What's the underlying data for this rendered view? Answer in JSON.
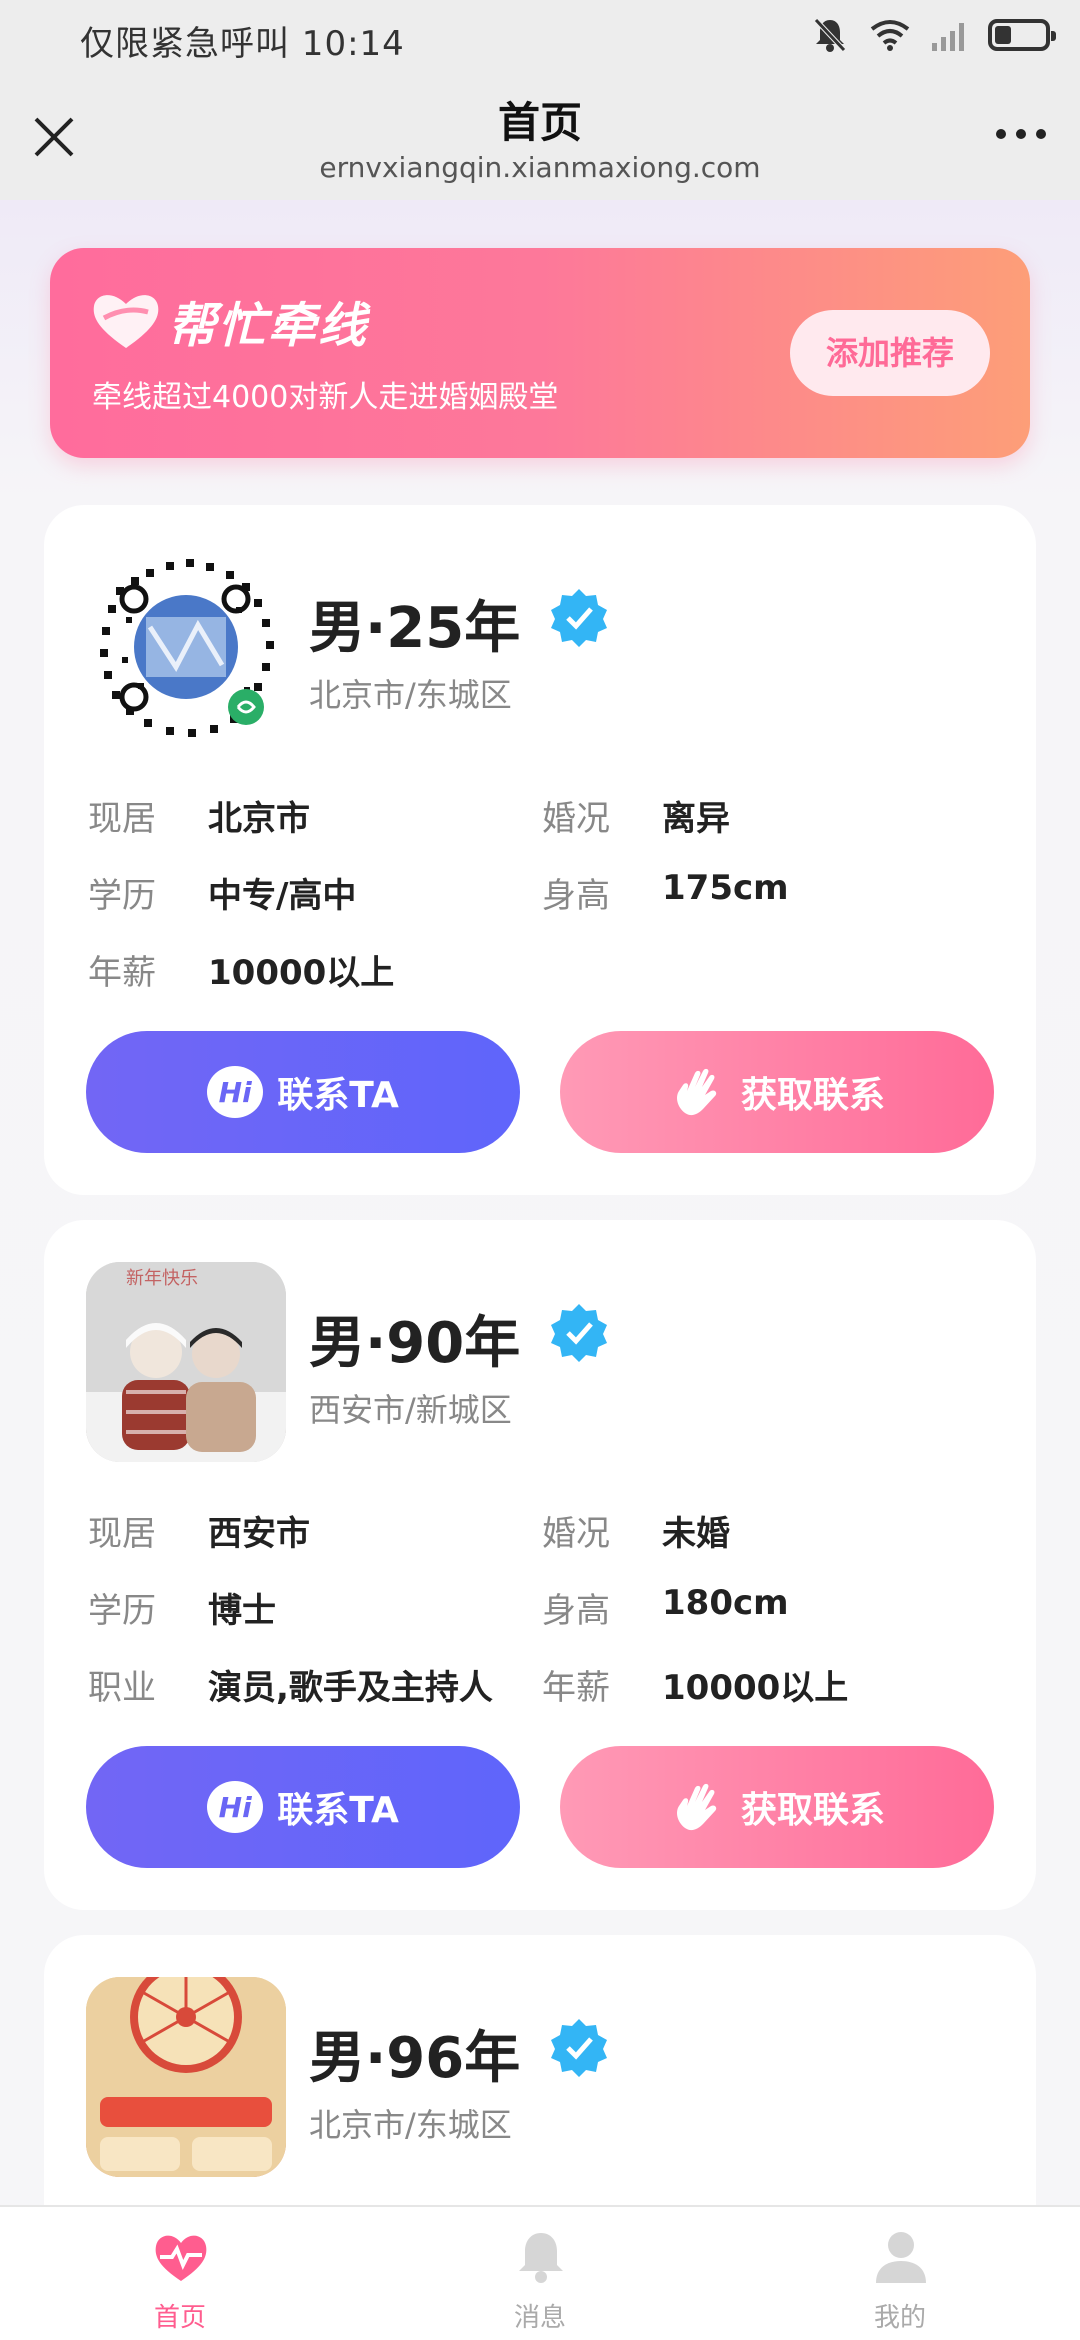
{
  "status_bar": {
    "left_text": "仅限紧急呼叫 10:14"
  },
  "nav": {
    "title": "首页",
    "subtitle": "ernvxiangqin.xianmaxiong.com"
  },
  "banner": {
    "title": "帮忙牵线",
    "description": "牵线超过4000对新人走进婚姻殿堂",
    "button_label": "添加推荐"
  },
  "cards": [
    {
      "name": "男·25年",
      "city": "北京市/东城区",
      "rows": [
        {
          "l1": "现居",
          "v1": "北京市",
          "l2": "婚况",
          "v2": "离异"
        },
        {
          "l1": "学历",
          "v1": "中专/高中",
          "l2": "身高",
          "v2": "175cm"
        },
        {
          "l1": "年薪",
          "v1": "10000以上",
          "l2": "",
          "v2": ""
        }
      ],
      "contact_label": "联系TA",
      "get_label": "获取联系"
    },
    {
      "name": "男·90年",
      "city": "西安市/新城区",
      "rows": [
        {
          "l1": "现居",
          "v1": "西安市",
          "l2": "婚况",
          "v2": "未婚"
        },
        {
          "l1": "学历",
          "v1": "博士",
          "l2": "身高",
          "v2": "180cm"
        },
        {
          "l1": "职业",
          "v1": "演员,歌手及主持人",
          "l2": "年薪",
          "v2": "10000以上"
        }
      ],
      "contact_label": "联系TA",
      "get_label": "获取联系"
    },
    {
      "name": "男·96年",
      "city": "北京市/东城区"
    }
  ],
  "buttons": {
    "hi_text": "Hi"
  },
  "tabs": [
    {
      "label": "首页"
    },
    {
      "label": "消息"
    },
    {
      "label": "我的"
    }
  ],
  "colors": {
    "accent_pink": "#ff6a97",
    "accent_purple": "#6a66f5",
    "verify_blue": "#33b5f5"
  }
}
